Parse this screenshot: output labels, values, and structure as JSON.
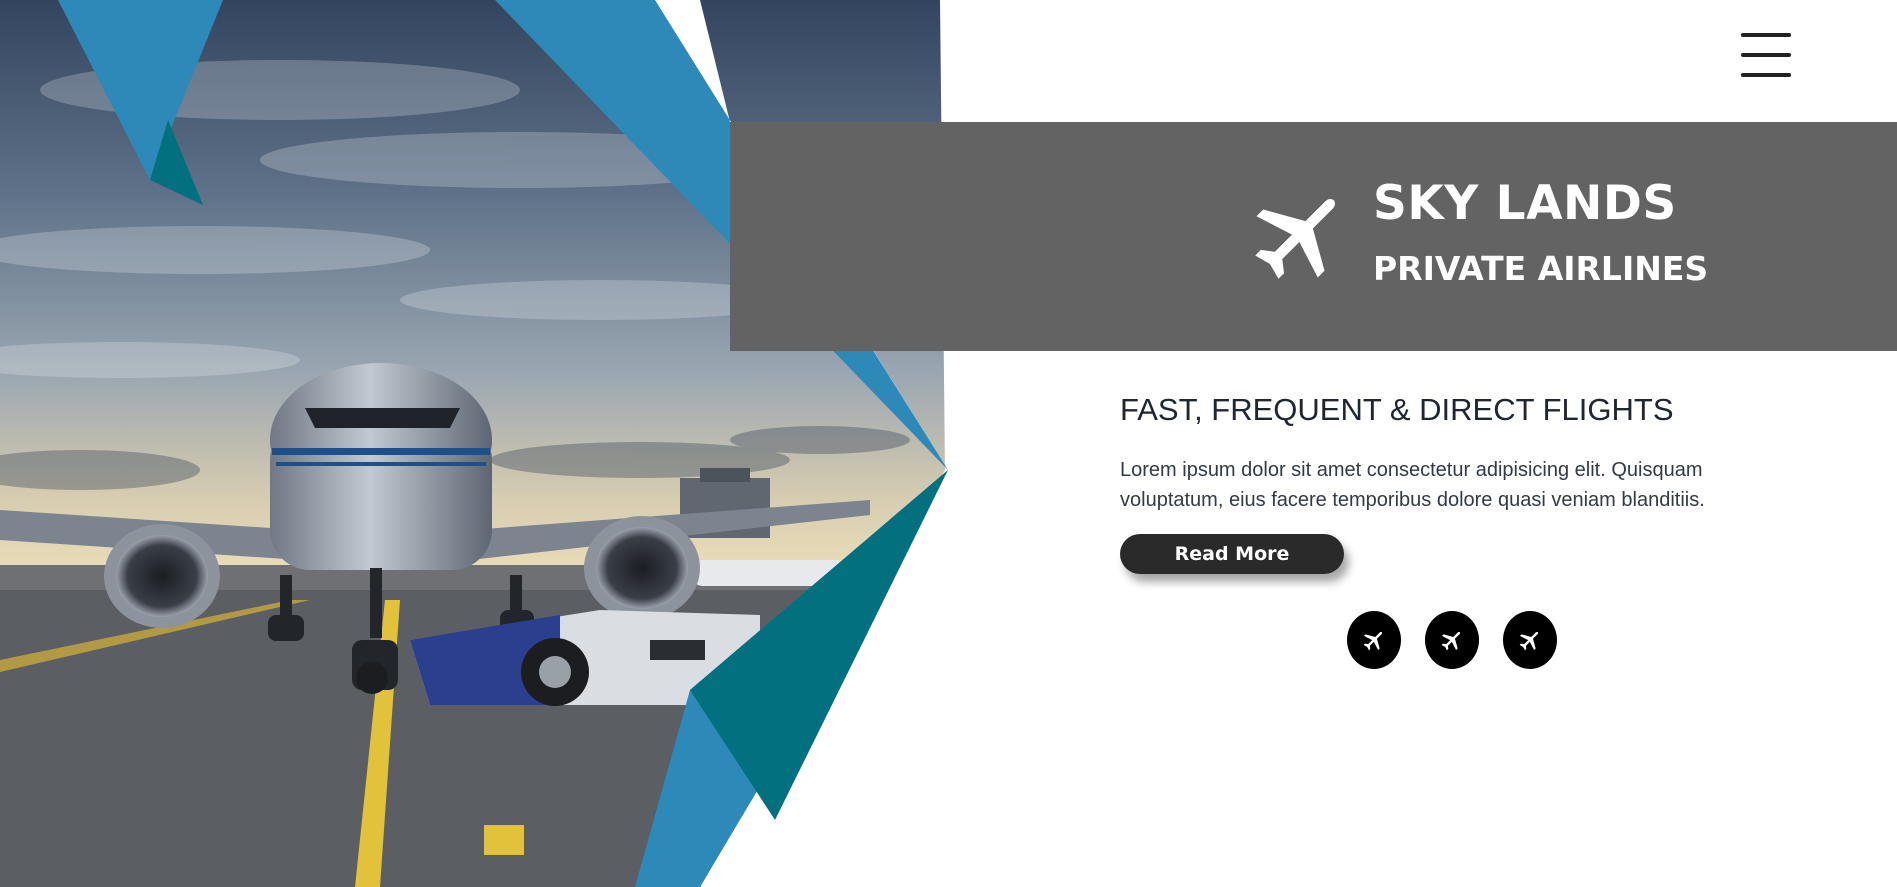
{
  "nav": {
    "menu_icon": "hamburger-menu-icon"
  },
  "brand": {
    "icon": "airplane-icon",
    "title": "SKY LANDS",
    "subtitle": "PRIVATE AIRLINES"
  },
  "content": {
    "headline": "FAST, FREQUENT & DIRECT FLIGHTS",
    "body": "Lorem ipsum dolor sit amet consectetur adipisicing elit. Quisquam voluptatum, eius facere temporibus dolore quasi veniam blanditiis.",
    "cta_label": "Read More"
  },
  "social_buttons": [
    {
      "icon": "airplane-icon"
    },
    {
      "icon": "airplane-icon"
    },
    {
      "icon": "airplane-icon"
    }
  ],
  "colors": {
    "accent_blue": "#2d8ab8",
    "accent_teal": "#02707f",
    "band_gray": "#636363",
    "button_dark": "#2a2a2a"
  }
}
